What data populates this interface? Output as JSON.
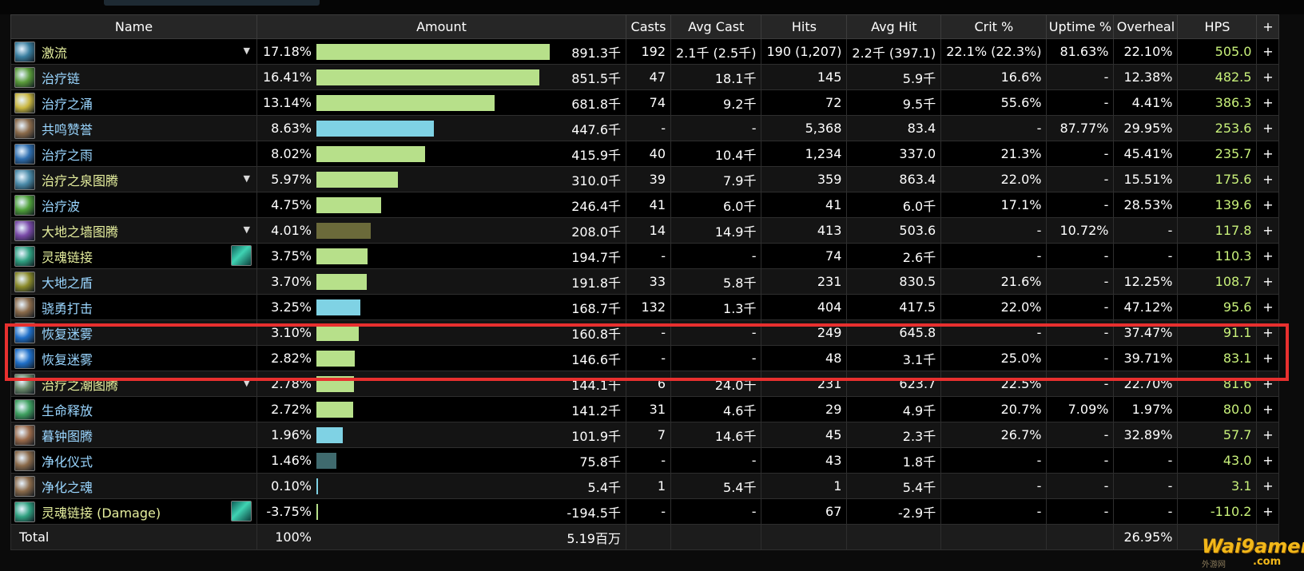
{
  "columns": {
    "name": "Name",
    "amount": "Amount",
    "casts": "Casts",
    "avg_cast": "Avg Cast",
    "hits": "Hits",
    "avg_hit": "Avg Hit",
    "crit": "Crit %",
    "uptime": "Uptime %",
    "overheal": "Overheal",
    "hps": "HPS",
    "add": "+"
  },
  "rows": [
    {
      "name": "激流",
      "icon": "riptide-icon",
      "icon_color": "#3a7fa0",
      "dropdown": true,
      "pet_icon": false,
      "pct": "17.18%",
      "bar_fraction": 0.1718,
      "bar_color": "#b7e08a",
      "amount": "891.3千",
      "casts": "192",
      "avg_cast": "2.1千 (2.5千)",
      "hits": "190 (1,207)",
      "avg_hit": "2.2千 (397.1)",
      "crit": "22.1% (22.3%)",
      "uptime": "81.63%",
      "overheal": "22.10%",
      "hps": "505.0",
      "plus": "+"
    },
    {
      "name": "治疗链",
      "icon": "chain-heal-icon",
      "icon_color": "#5a9b3a",
      "dropdown": false,
      "pet_icon": false,
      "pct": "16.41%",
      "bar_fraction": 0.1641,
      "bar_color": "#b7e08a",
      "amount": "851.5千",
      "casts": "47",
      "avg_cast": "18.1千",
      "hits": "145",
      "avg_hit": "5.9千",
      "crit": "16.6%",
      "uptime": "-",
      "overheal": "12.38%",
      "hps": "482.5",
      "plus": "+"
    },
    {
      "name": "治疗之涌",
      "icon": "healing-surge-icon",
      "icon_color": "#c9b640",
      "dropdown": false,
      "pet_icon": false,
      "pct": "13.14%",
      "bar_fraction": 0.1314,
      "bar_color": "#b7e08a",
      "amount": "681.8千",
      "casts": "74",
      "avg_cast": "9.2千",
      "hits": "72",
      "avg_hit": "9.5千",
      "crit": "55.6%",
      "uptime": "-",
      "overheal": "4.41%",
      "hps": "386.3",
      "plus": "+"
    },
    {
      "name": "共鸣赞誉",
      "icon": "echoing-reprimand-icon",
      "icon_color": "#8a6a4a",
      "dropdown": false,
      "pet_icon": false,
      "pct": "8.63%",
      "bar_fraction": 0.0863,
      "bar_color": "#7fd2e4",
      "amount": "447.6千",
      "casts": "-",
      "avg_cast": "-",
      "hits": "5,368",
      "avg_hit": "83.4",
      "crit": "-",
      "uptime": "87.77%",
      "overheal": "29.95%",
      "hps": "253.6",
      "plus": "+"
    },
    {
      "name": "治疗之雨",
      "icon": "healing-rain-icon",
      "icon_color": "#2f6fb0",
      "dropdown": false,
      "pet_icon": false,
      "pct": "8.02%",
      "bar_fraction": 0.0802,
      "bar_color": "#b7e08a",
      "amount": "415.9千",
      "casts": "40",
      "avg_cast": "10.4千",
      "hits": "1,234",
      "avg_hit": "337.0",
      "crit": "21.3%",
      "uptime": "-",
      "overheal": "45.41%",
      "hps": "235.7",
      "plus": "+"
    },
    {
      "name": "治疗之泉图腾",
      "icon": "healing-stream-totem-icon",
      "icon_color": "#4a8aa8",
      "dropdown": true,
      "pet_icon": false,
      "pct": "5.97%",
      "bar_fraction": 0.0597,
      "bar_color": "#b7e08a",
      "amount": "310.0千",
      "casts": "39",
      "avg_cast": "7.9千",
      "hits": "359",
      "avg_hit": "863.4",
      "crit": "22.0%",
      "uptime": "-",
      "overheal": "15.51%",
      "hps": "175.6",
      "plus": "+"
    },
    {
      "name": "治疗波",
      "icon": "healing-wave-icon",
      "icon_color": "#4fa03a",
      "dropdown": false,
      "pet_icon": false,
      "pct": "4.75%",
      "bar_fraction": 0.0475,
      "bar_color": "#b7e08a",
      "amount": "246.4千",
      "casts": "41",
      "avg_cast": "6.0千",
      "hits": "41",
      "avg_hit": "6.0千",
      "crit": "17.1%",
      "uptime": "-",
      "overheal": "28.53%",
      "hps": "139.6",
      "plus": "+"
    },
    {
      "name": "大地之墙图腾",
      "icon": "earthen-wall-totem-icon",
      "icon_color": "#7a4aa8",
      "dropdown": true,
      "pet_icon": false,
      "pct": "4.01%",
      "bar_fraction": 0.0401,
      "bar_color": "#6b6a3a",
      "amount": "208.0千",
      "casts": "14",
      "avg_cast": "14.9千",
      "hits": "413",
      "avg_hit": "503.6",
      "crit": "-",
      "uptime": "10.72%",
      "overheal": "-",
      "hps": "117.8",
      "plus": "+"
    },
    {
      "name": "灵魂链接",
      "icon": "spirit-link-icon",
      "icon_color": "#2fa080",
      "dropdown": false,
      "pet_icon": true,
      "pct": "3.75%",
      "bar_fraction": 0.0375,
      "bar_color": "#b7e08a",
      "amount": "194.7千",
      "casts": "-",
      "avg_cast": "-",
      "hits": "74",
      "avg_hit": "2.6千",
      "crit": "-",
      "uptime": "-",
      "overheal": "-",
      "hps": "110.3",
      "plus": "+"
    },
    {
      "name": "大地之盾",
      "icon": "earth-shield-icon",
      "icon_color": "#8a8a2a",
      "dropdown": false,
      "pet_icon": false,
      "pct": "3.70%",
      "bar_fraction": 0.037,
      "bar_color": "#b7e08a",
      "amount": "191.8千",
      "casts": "33",
      "avg_cast": "5.8千",
      "hits": "231",
      "avg_hit": "830.5",
      "crit": "21.6%",
      "uptime": "-",
      "overheal": "12.25%",
      "hps": "108.7",
      "plus": "+"
    },
    {
      "name": "骁勇打击",
      "icon": "valorous-strike-icon",
      "icon_color": "#8a6a4a",
      "dropdown": false,
      "pet_icon": false,
      "pct": "3.25%",
      "bar_fraction": 0.0325,
      "bar_color": "#7fd2e4",
      "amount": "168.7千",
      "casts": "132",
      "avg_cast": "1.3千",
      "hits": "404",
      "avg_hit": "417.5",
      "crit": "22.0%",
      "uptime": "-",
      "overheal": "47.12%",
      "hps": "95.6",
      "plus": "+"
    },
    {
      "name": "恢复迷雾",
      "icon": "revival-mist-icon",
      "icon_color": "#1f6fc8",
      "dropdown": false,
      "pet_icon": false,
      "pct": "3.10%",
      "bar_fraction": 0.031,
      "bar_color": "#b7e08a",
      "amount": "160.8千",
      "casts": "-",
      "avg_cast": "-",
      "hits": "249",
      "avg_hit": "645.8",
      "crit": "-",
      "uptime": "-",
      "overheal": "37.47%",
      "hps": "91.1",
      "plus": "+"
    },
    {
      "name": "恢复迷雾",
      "icon": "revival-mist-icon",
      "icon_color": "#1f6fc8",
      "dropdown": false,
      "pet_icon": false,
      "pct": "2.82%",
      "bar_fraction": 0.0282,
      "bar_color": "#b7e08a",
      "amount": "146.6千",
      "casts": "-",
      "avg_cast": "-",
      "hits": "48",
      "avg_hit": "3.1千",
      "crit": "25.0%",
      "uptime": "-",
      "overheal": "39.71%",
      "hps": "83.1",
      "plus": "+"
    },
    {
      "name": "治疗之潮图腾",
      "icon": "healing-tide-totem-icon",
      "icon_color": "#6a8a6a",
      "dropdown": true,
      "pet_icon": false,
      "pct": "2.78%",
      "bar_fraction": 0.0278,
      "bar_color": "#b7e08a",
      "amount": "144.1千",
      "casts": "6",
      "avg_cast": "24.0千",
      "hits": "231",
      "avg_hit": "623.7",
      "crit": "22.5%",
      "uptime": "-",
      "overheal": "22.70%",
      "hps": "81.6",
      "plus": "+"
    },
    {
      "name": "生命释放",
      "icon": "unleash-life-icon",
      "icon_color": "#3fa060",
      "dropdown": false,
      "pet_icon": false,
      "pct": "2.72%",
      "bar_fraction": 0.0272,
      "bar_color": "#b7e08a",
      "amount": "141.2千",
      "casts": "31",
      "avg_cast": "4.6千",
      "hits": "29",
      "avg_hit": "4.9千",
      "crit": "20.7%",
      "uptime": "7.09%",
      "overheal": "1.97%",
      "hps": "80.0",
      "plus": "+"
    },
    {
      "name": "暮钟图腾",
      "icon": "vesper-totem-icon",
      "icon_color": "#9a6a4a",
      "dropdown": false,
      "pet_icon": false,
      "pct": "1.96%",
      "bar_fraction": 0.0196,
      "bar_color": "#7fd2e4",
      "amount": "101.9千",
      "casts": "7",
      "avg_cast": "14.6千",
      "hits": "45",
      "avg_hit": "2.3千",
      "crit": "26.7%",
      "uptime": "-",
      "overheal": "32.89%",
      "hps": "57.7",
      "plus": "+"
    },
    {
      "name": "净化仪式",
      "icon": "purification-ritual-icon",
      "icon_color": "#8a6a4a",
      "dropdown": false,
      "pet_icon": false,
      "pct": "1.46%",
      "bar_fraction": 0.0146,
      "bar_color": "#3f6a6e",
      "amount": "75.8千",
      "casts": "-",
      "avg_cast": "-",
      "hits": "43",
      "avg_hit": "1.8千",
      "crit": "-",
      "uptime": "-",
      "overheal": "-",
      "hps": "43.0",
      "plus": "+"
    },
    {
      "name": "净化之魂",
      "icon": "purify-soul-icon",
      "icon_color": "#8a6a4a",
      "dropdown": false,
      "pet_icon": false,
      "pct": "0.10%",
      "bar_fraction": 0.001,
      "bar_color": "#7fd2e4",
      "amount": "5.4千",
      "casts": "1",
      "avg_cast": "5.4千",
      "hits": "1",
      "avg_hit": "5.4千",
      "crit": "-",
      "uptime": "-",
      "overheal": "-",
      "hps": "3.1",
      "plus": "+"
    },
    {
      "name": "灵魂链接 (Damage)",
      "icon": "spirit-link-icon",
      "icon_color": "#2fa080",
      "dropdown": false,
      "pet_icon": true,
      "pct": "-3.75%",
      "bar_fraction": 0.001,
      "bar_color": "#b7e08a",
      "amount": "-194.5千",
      "casts": "-",
      "avg_cast": "-",
      "hits": "67",
      "avg_hit": "-2.9千",
      "crit": "-",
      "uptime": "-",
      "overheal": "-",
      "hps": "-110.2",
      "plus": "+"
    }
  ],
  "total": {
    "label": "Total",
    "pct": "100%",
    "amount": "5.19百万",
    "overheal": "26.95%"
  },
  "bar_scale_max": 0.1823,
  "highlight_color": "#e8302f",
  "hps_color": "#c8f07a",
  "watermark": {
    "main": "Wai9amer",
    "sub": ".com",
    "cn": "外游网"
  }
}
